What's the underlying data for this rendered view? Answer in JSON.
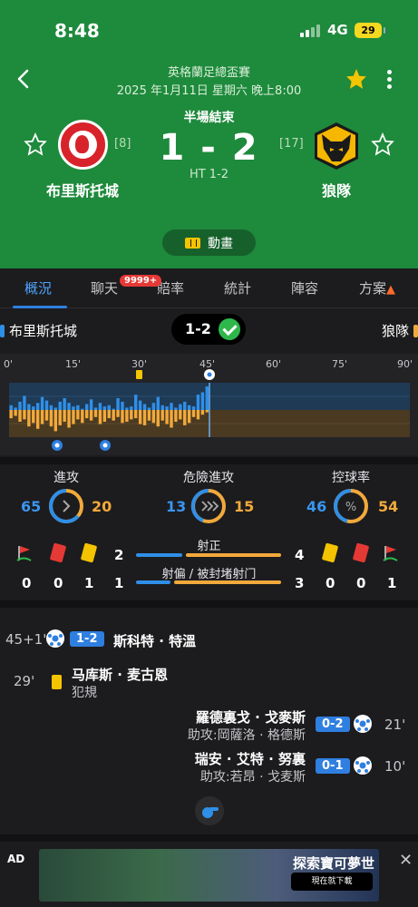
{
  "status_bar": {
    "time": "8:48",
    "network": "4G",
    "battery": "29"
  },
  "match": {
    "competition": "英格蘭足總盃賽",
    "datetime": "2025 年1月11日 星期六 晚上8:00",
    "status": "半場結束",
    "score": "1 - 2",
    "half_time": "HT 1-2",
    "home": {
      "name": "布里斯托城",
      "rank": "[8]"
    },
    "away": {
      "name": "狼隊",
      "rank": "[17]"
    },
    "animation_label": "動畫"
  },
  "tabs": [
    {
      "label": "概況",
      "active": true
    },
    {
      "label": "聊天",
      "badge": "9999+"
    },
    {
      "label": "賠率"
    },
    {
      "label": "統計"
    },
    {
      "label": "陣容"
    },
    {
      "label": "方案"
    }
  ],
  "momentum": {
    "home": "布里斯托城",
    "away": "狼隊",
    "score": "1-2",
    "minute_labels": [
      "0'",
      "15'",
      "30'",
      "45'",
      "60'",
      "75'",
      "90'"
    ],
    "home_bars": [
      0.2,
      0.1,
      0.35,
      0.6,
      0.25,
      0.15,
      0.3,
      0.55,
      0.4,
      0.2,
      0.1,
      0.35,
      0.5,
      0.3,
      0.15,
      0.2,
      0.05,
      0.25,
      0.45,
      0.1,
      0.3,
      0.15,
      0.2,
      0.05,
      0.5,
      0.35,
      0.1,
      0.15,
      0.65,
      0.4,
      0.25,
      0.1,
      0.3,
      0.55,
      0.2,
      0.15,
      0.3,
      0.1,
      0.25,
      0.35,
      0.2,
      0.15,
      0.65,
      0.75,
      1.0
    ],
    "away_bars": [
      0.35,
      0.25,
      0.5,
      0.4,
      0.7,
      0.55,
      0.8,
      0.6,
      0.45,
      0.7,
      0.9,
      0.65,
      0.5,
      0.75,
      0.6,
      0.4,
      0.55,
      0.35,
      0.45,
      0.3,
      0.6,
      0.5,
      0.35,
      0.45,
      0.3,
      0.55,
      0.5,
      0.4,
      0.35,
      0.6,
      0.65,
      0.45,
      0.55,
      0.7,
      0.45,
      0.6,
      0.75,
      0.5,
      0.4,
      0.65,
      0.55,
      0.3,
      0.4,
      0.2,
      0.1
    ]
  },
  "stats": {
    "attack": {
      "label": "進攻",
      "home": "65",
      "away": "20"
    },
    "dangerous": {
      "label": "危險進攻",
      "home": "13",
      "away": "15"
    },
    "possession": {
      "label": "控球率",
      "home": "46",
      "away": "54"
    },
    "shots_on_target": {
      "label": "射正",
      "home": "2",
      "away": "4",
      "home_share": 0.33
    },
    "shots_off": {
      "label": "射偏 / 被封堵射门",
      "home": "1",
      "away": "3",
      "home_share": 0.25
    },
    "home_corners": "0",
    "home_red": "0",
    "home_yellow": "1",
    "away_corners": "1",
    "away_red": "0",
    "away_yellow": "0"
  },
  "events": [
    {
      "minute": "45+1'",
      "score": "1-2",
      "player": "斯科特 · 特溫"
    },
    {
      "minute": "29'",
      "player": "马库斯 · 麦古恩",
      "detail": "犯規"
    },
    {
      "minute": "21'",
      "score": "0-2",
      "player": "羅德裏戈 · 戈麥斯",
      "detail": "助攻:岡薩洛 · 格德斯"
    },
    {
      "minute": "10'",
      "score": "0-1",
      "player": "瑞安 · 艾特 · 努裏",
      "detail": "助攻:若昂 · 戈麦斯"
    }
  ],
  "ad": {
    "label": "AD",
    "headline": "探索寶可夢世界",
    "store": "現在就下載"
  },
  "colors": {
    "header": "#1e8a3c",
    "home": "#2f8fe8",
    "away": "#f2a93b"
  }
}
